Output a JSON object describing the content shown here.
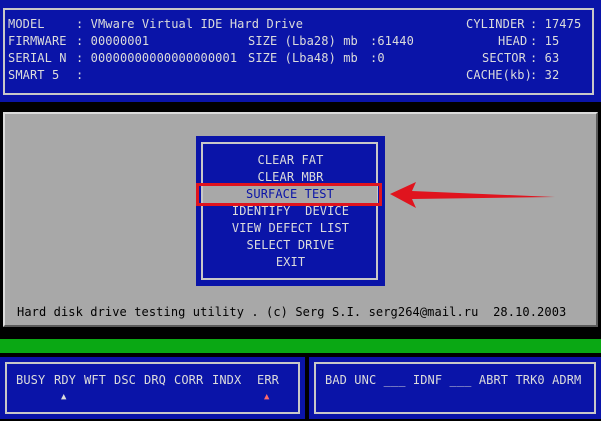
{
  "drive_info": {
    "model_label": "MODEL",
    "model_value": ": VMware Virtual IDE Hard Drive",
    "firmware_label": "FIRMWARE",
    "firmware_value": ": 00000001",
    "serial_label": "SERIAL N",
    "serial_value": ": 00000000000000000001",
    "smart_label": "SMART 5",
    "smart_value": ":",
    "size28_label": "SIZE (Lba28) mb",
    "size28_value": ":61440",
    "size48_label": "SIZE (Lba48) mb",
    "size48_value": ":0",
    "cylinder_label": "CYLINDER",
    "cylinder_value": ": 17475",
    "head_label": "HEAD",
    "head_value": ": 15",
    "sector_label": "SECTOR",
    "sector_value": ": 63",
    "cache_label": "CACHE(kb)",
    "cache_value": ": 32"
  },
  "menu": {
    "items": [
      "CLEAR FAT",
      "CLEAR MBR",
      "SURFACE TEST",
      "IDENTIFY  DEVICE",
      "VIEW DEFECT LIST",
      "SELECT DRIVE",
      "EXIT"
    ],
    "selected": "SURFACE TEST"
  },
  "footer": {
    "text": "Hard disk drive testing utility . (c) Serg S.I. serg264@mail.ru  28.10.2003"
  },
  "status_left": {
    "flags": [
      "BUSY",
      "RDY",
      "WFT",
      "DSC",
      "DRQ",
      "CORR",
      "INDX",
      "ERR"
    ],
    "indicator": "▲"
  },
  "status_right": {
    "text": "BAD UNC ___ IDNF ___ ABRT TRK0 ADRM"
  },
  "colors": {
    "panel_blue": "#0a14a8",
    "gray": "#a8a8a8",
    "green": "#0aa814",
    "annotation_red": "#e0141e"
  },
  "icons": {
    "arrow": "red-arrow-pointer"
  }
}
